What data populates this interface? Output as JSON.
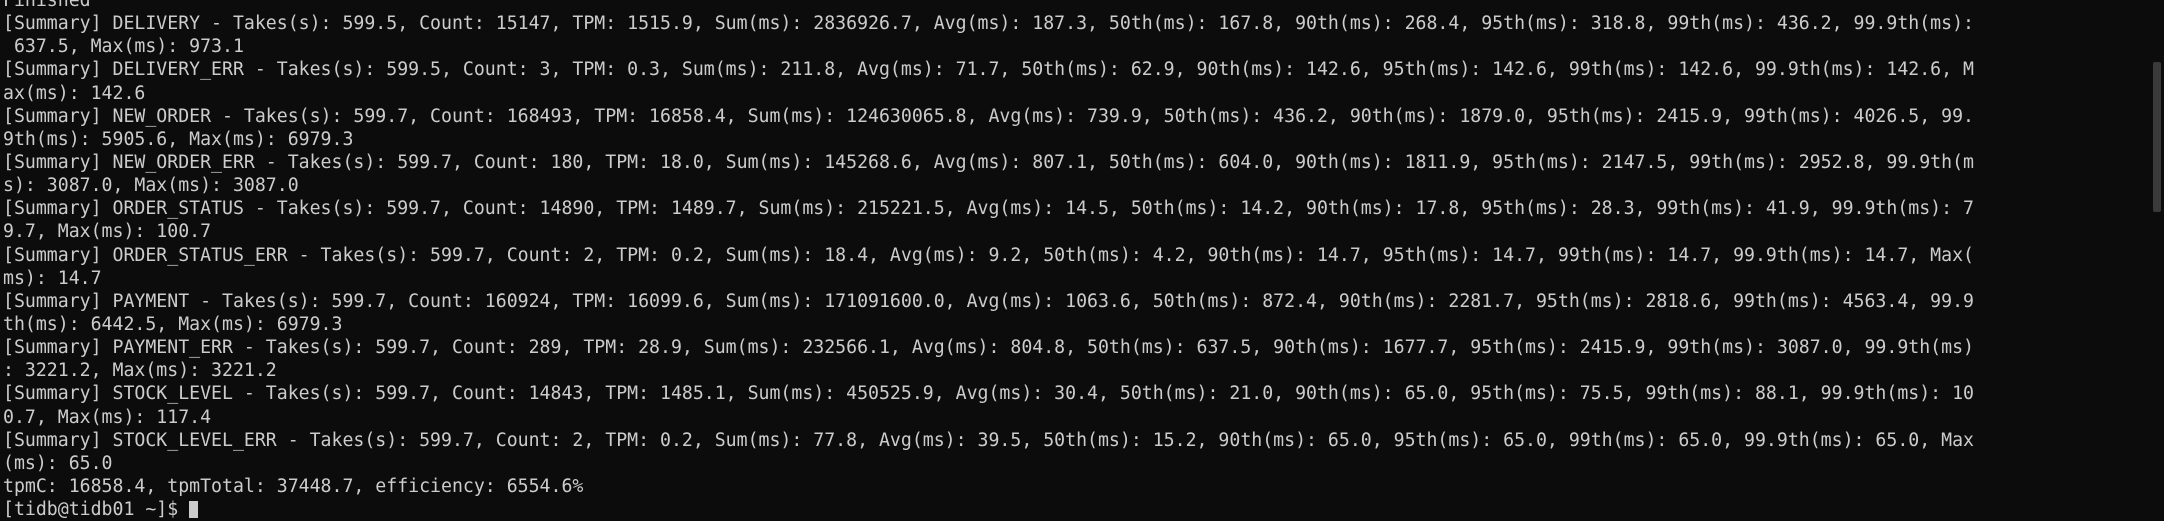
{
  "terminal": {
    "lines": [
      "Finished",
      "[Summary] DELIVERY - Takes(s): 599.5, Count: 15147, TPM: 1515.9, Sum(ms): 2836926.7, Avg(ms): 187.3, 50th(ms): 167.8, 90th(ms): 268.4, 95th(ms): 318.8, 99th(ms): 436.2, 99.9th(ms):",
      " 637.5, Max(ms): 973.1",
      "[Summary] DELIVERY_ERR - Takes(s): 599.5, Count: 3, TPM: 0.3, Sum(ms): 211.8, Avg(ms): 71.7, 50th(ms): 62.9, 90th(ms): 142.6, 95th(ms): 142.6, 99th(ms): 142.6, 99.9th(ms): 142.6, M",
      "ax(ms): 142.6",
      "[Summary] NEW_ORDER - Takes(s): 599.7, Count: 168493, TPM: 16858.4, Sum(ms): 124630065.8, Avg(ms): 739.9, 50th(ms): 436.2, 90th(ms): 1879.0, 95th(ms): 2415.9, 99th(ms): 4026.5, 99.",
      "9th(ms): 5905.6, Max(ms): 6979.3",
      "[Summary] NEW_ORDER_ERR - Takes(s): 599.7, Count: 180, TPM: 18.0, Sum(ms): 145268.6, Avg(ms): 807.1, 50th(ms): 604.0, 90th(ms): 1811.9, 95th(ms): 2147.5, 99th(ms): 2952.8, 99.9th(m",
      "s): 3087.0, Max(ms): 3087.0",
      "[Summary] ORDER_STATUS - Takes(s): 599.7, Count: 14890, TPM: 1489.7, Sum(ms): 215221.5, Avg(ms): 14.5, 50th(ms): 14.2, 90th(ms): 17.8, 95th(ms): 28.3, 99th(ms): 41.9, 99.9th(ms): 7",
      "9.7, Max(ms): 100.7",
      "[Summary] ORDER_STATUS_ERR - Takes(s): 599.7, Count: 2, TPM: 0.2, Sum(ms): 18.4, Avg(ms): 9.2, 50th(ms): 4.2, 90th(ms): 14.7, 95th(ms): 14.7, 99th(ms): 14.7, 99.9th(ms): 14.7, Max(",
      "ms): 14.7",
      "[Summary] PAYMENT - Takes(s): 599.7, Count: 160924, TPM: 16099.6, Sum(ms): 171091600.0, Avg(ms): 1063.6, 50th(ms): 872.4, 90th(ms): 2281.7, 95th(ms): 2818.6, 99th(ms): 4563.4, 99.9",
      "th(ms): 6442.5, Max(ms): 6979.3",
      "[Summary] PAYMENT_ERR - Takes(s): 599.7, Count: 289, TPM: 28.9, Sum(ms): 232566.1, Avg(ms): 804.8, 50th(ms): 637.5, 90th(ms): 1677.7, 95th(ms): 2415.9, 99th(ms): 3087.0, 99.9th(ms)",
      ": 3221.2, Max(ms): 3221.2",
      "[Summary] STOCK_LEVEL - Takes(s): 599.7, Count: 14843, TPM: 1485.1, Sum(ms): 450525.9, Avg(ms): 30.4, 50th(ms): 21.0, 90th(ms): 65.0, 95th(ms): 75.5, 99th(ms): 88.1, 99.9th(ms): 10",
      "0.7, Max(ms): 117.4",
      "[Summary] STOCK_LEVEL_ERR - Takes(s): 599.7, Count: 2, TPM: 0.2, Sum(ms): 77.8, Avg(ms): 39.5, 50th(ms): 15.2, 90th(ms): 65.0, 95th(ms): 65.0, 99th(ms): 65.0, 99.9th(ms): 65.0, Max",
      "(ms): 65.0",
      "tpmC: 16858.4, tpmTotal: 37448.7, efficiency: 6554.6%",
      "[tidb@tidb01 ~]$ "
    ],
    "text_color": "#cccccc",
    "background_color": "#0c0c0c"
  }
}
